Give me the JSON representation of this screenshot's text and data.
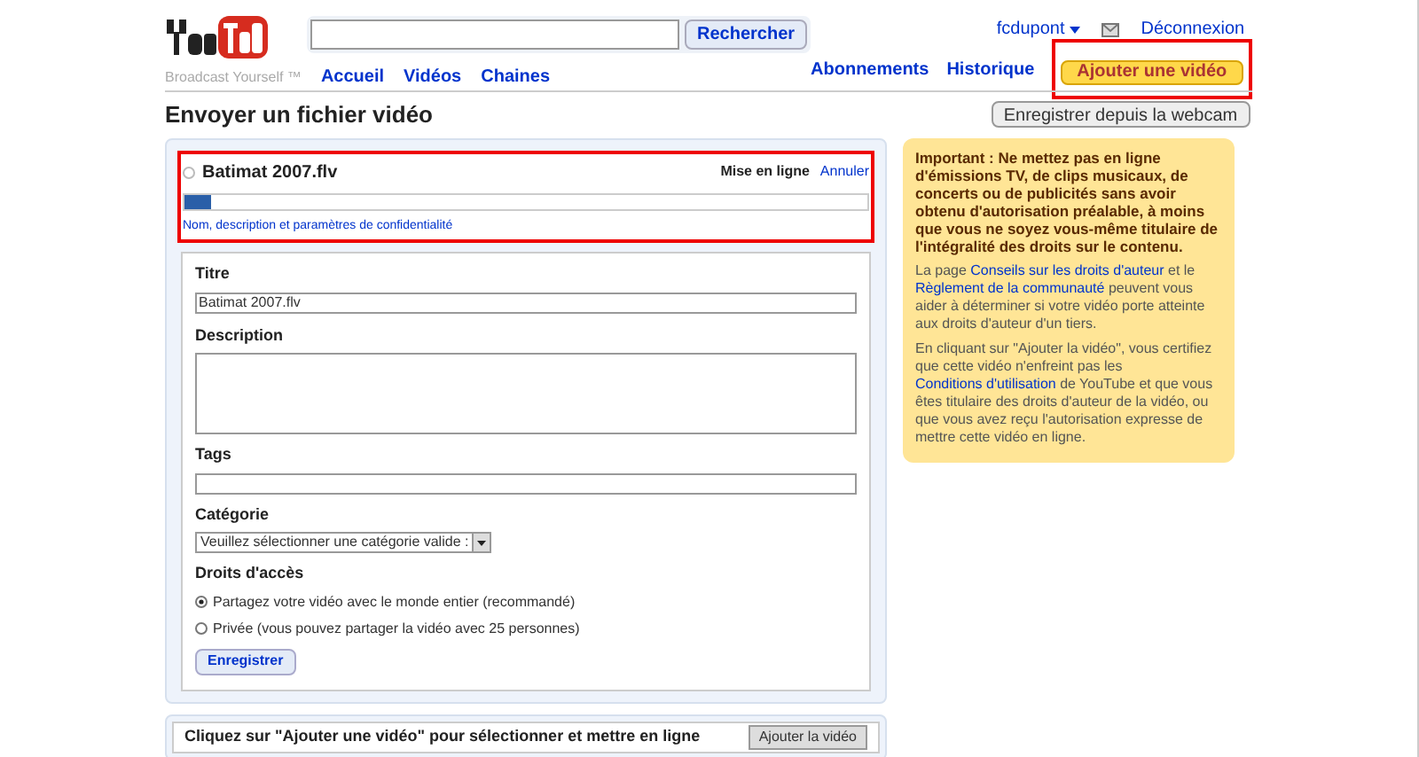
{
  "header": {
    "tagline": "Broadcast Yourself ™",
    "search": {
      "button": "Rechercher"
    },
    "nav": [
      "Accueil",
      "Vidéos",
      "Chaines"
    ],
    "user": "fcdupont",
    "logout": "Déconnexion",
    "links": [
      "Abonnements",
      "Historique"
    ],
    "add_video": {
      "label": "Ajouter une vidéo",
      "highlighted": true
    }
  },
  "page_title": "Envoyer un fichier vidéo",
  "webcam_button": "Enregistrer depuis la webcam",
  "upload": {
    "highlighted": true,
    "file_name": "Batimat 2007.flv",
    "status": "Mise en ligne",
    "cancel": "Annuler",
    "level": 0.04,
    "details_link": "Nom, description et paramètres de confidentialité"
  },
  "form": {
    "title_label": "Titre",
    "title_value": "Batimat 2007.flv",
    "description_label": "Description",
    "tags_label": "Tags",
    "category_label": "Catégorie",
    "category_value": "Veuillez sélectionner une catégorie valide :",
    "access_label": "Droits d'accès",
    "access_options": [
      {
        "label": "Partagez votre vidéo avec le monde entier (recommandé)",
        "selected": true
      },
      {
        "label": "Privée (vous pouvez partager la vidéo avec 25 personnes)",
        "selected": false
      }
    ],
    "save_button": "Enregistrer"
  },
  "bottom": {
    "text": "Cliquez sur \"Ajouter une vidéo\" pour sélectionner et mettre en ligne",
    "button": "Ajouter la vidéo"
  },
  "notice": [
    {
      "kind": "warning",
      "parts": [
        {
          "text": "Important : Ne mettez pas en ligne d'émissions TV, de clips musicaux, de concerts ou de publicités sans avoir obtenu d'autorisation préalable, à moins que vous ne soyez vous-même titulaire de l'intégralité des droits sur le contenu."
        }
      ]
    },
    {
      "kind": "info",
      "parts": [
        {
          "text": "La page "
        },
        {
          "text": "Conseils sur les droits d'auteur",
          "link": true
        },
        {
          "text": " et le "
        },
        {
          "text": "Règlement de la communauté",
          "link": true
        },
        {
          "text": " peuvent vous aider à déterminer si votre vidéo porte atteinte aux droits d'auteur d'un tiers."
        }
      ]
    },
    {
      "kind": "info",
      "parts": [
        {
          "text": "En cliquant sur \"Ajouter la vidéo\", vous certifiez que cette vidéo n'enfreint pas les "
        },
        {
          "text": "Conditions d'utilisation",
          "link": true
        },
        {
          "text": " de YouTube et que vous êtes titulaire des droits d'auteur de la vidéo, ou que vous avez reçu l'autorisation expresse de mettre cette vidéo en ligne."
        }
      ]
    }
  ]
}
